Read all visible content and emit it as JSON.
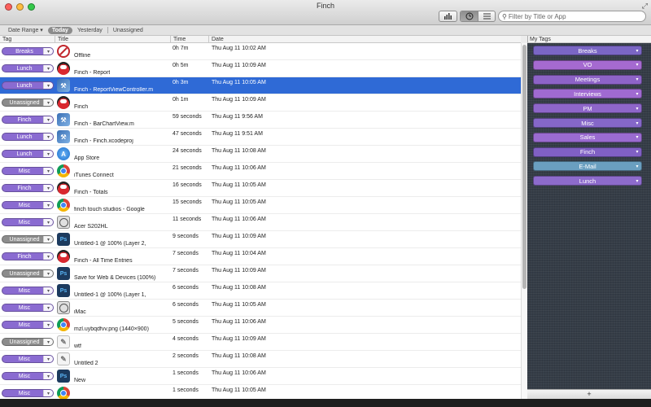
{
  "window": {
    "title": "Finch"
  },
  "toolbar": {
    "chart_icon": "bar-chart-icon",
    "clock_icon": "clock-icon",
    "list_icon": "list-icon",
    "search_placeholder": "Filter by Title or App"
  },
  "filters": {
    "date_range": "Date Range ▾",
    "today": "Today",
    "yesterday": "Yesterday",
    "unassigned": "Unassigned"
  },
  "columns": {
    "tag": "Tag",
    "title": "Title",
    "time": "Time",
    "date": "Date"
  },
  "rows": [
    {
      "tag": "Breaks",
      "tag_color": "#8a6bd1",
      "icon": "offline",
      "title": "Offline",
      "time": "0h 7m",
      "date": "Thu Aug 11 10:02 AM"
    },
    {
      "tag": "Lunch",
      "tag_color": "#8a6bd1",
      "icon": "finch",
      "title": "Finch - Report",
      "time": "0h 5m",
      "date": "Thu Aug 11 10:09 AM"
    },
    {
      "tag": "Lunch",
      "tag_color": "#8a6bd1",
      "icon": "xcode",
      "title": "Finch - ReportViewController.m",
      "time": "0h 3m",
      "date": "Thu Aug 11 10:05 AM",
      "selected": true
    },
    {
      "tag": "Unassigned",
      "tag_color": "#8c8c8c",
      "icon": "finch",
      "title": "Finch",
      "time": "0h 1m",
      "date": "Thu Aug 11 10:09 AM"
    },
    {
      "tag": "Finch",
      "tag_color": "#8a6bd1",
      "icon": "xcode",
      "title": "Finch - BarChartView.m",
      "time": "59 seconds",
      "date": "Thu Aug 11 9:56 AM"
    },
    {
      "tag": "Lunch",
      "tag_color": "#8a6bd1",
      "icon": "xcode",
      "title": "Finch - Finch.xcodeproj",
      "time": "47 seconds",
      "date": "Thu Aug 11 9:51 AM"
    },
    {
      "tag": "Lunch",
      "tag_color": "#8a6bd1",
      "icon": "appstore",
      "title": "App Store",
      "time": "24 seconds",
      "date": "Thu Aug 11 10:08 AM"
    },
    {
      "tag": "Misc",
      "tag_color": "#8a6bd1",
      "icon": "chrome",
      "title": "iTunes Connect",
      "time": "21 seconds",
      "date": "Thu Aug 11 10:06 AM"
    },
    {
      "tag": "Finch",
      "tag_color": "#8a6bd1",
      "icon": "finch",
      "title": "Finch - Totals",
      "time": "16 seconds",
      "date": "Thu Aug 11 10:05 AM"
    },
    {
      "tag": "Misc",
      "tag_color": "#8a6bd1",
      "icon": "chrome",
      "title": "finch touch studios - Google",
      "time": "15 seconds",
      "date": "Thu Aug 11 10:05 AM"
    },
    {
      "tag": "Misc",
      "tag_color": "#8a6bd1",
      "icon": "display",
      "title": "Acer S202HL",
      "time": "11 seconds",
      "date": "Thu Aug 11 10:06 AM"
    },
    {
      "tag": "Unassigned",
      "tag_color": "#8c8c8c",
      "icon": "ps",
      "title": "Untitled-1 @ 100% (Layer 2,",
      "time": "9 seconds",
      "date": "Thu Aug 11 10:09 AM"
    },
    {
      "tag": "Finch",
      "tag_color": "#8a6bd1",
      "icon": "finch",
      "title": "Finch - All Time Entries",
      "time": "7 seconds",
      "date": "Thu Aug 11 10:04 AM"
    },
    {
      "tag": "Unassigned",
      "tag_color": "#8c8c8c",
      "icon": "ps",
      "title": "Save for Web & Devices (100%)",
      "time": "7 seconds",
      "date": "Thu Aug 11 10:09 AM"
    },
    {
      "tag": "Misc",
      "tag_color": "#8a6bd1",
      "icon": "ps",
      "title": "Untitled-1 @ 100% (Layer 1,",
      "time": "6 seconds",
      "date": "Thu Aug 11 10:08 AM"
    },
    {
      "tag": "Misc",
      "tag_color": "#8a6bd1",
      "icon": "display",
      "title": "iMac",
      "time": "6 seconds",
      "date": "Thu Aug 11 10:05 AM"
    },
    {
      "tag": "Misc",
      "tag_color": "#8a6bd1",
      "icon": "chrome",
      "title": "mzl.uybqdfvv.png (1440×900)",
      "time": "5 seconds",
      "date": "Thu Aug 11 10:06 AM"
    },
    {
      "tag": "Unassigned",
      "tag_color": "#8c8c8c",
      "icon": "sketch",
      "title": "wtf",
      "time": "4 seconds",
      "date": "Thu Aug 11 10:09 AM"
    },
    {
      "tag": "Misc",
      "tag_color": "#8a6bd1",
      "icon": "sketch",
      "title": "Untitled 2",
      "time": "2 seconds",
      "date": "Thu Aug 11 10:08 AM"
    },
    {
      "tag": "Misc",
      "tag_color": "#8a6bd1",
      "icon": "ps",
      "title": "New",
      "time": "1 seconds",
      "date": "Thu Aug 11 10:06 AM"
    },
    {
      "tag": "Misc",
      "tag_color": "#8a6bd1",
      "icon": "chrome",
      "title": "",
      "time": "1 seconds",
      "date": "Thu Aug 11 10:05 AM"
    }
  ],
  "my_tags": {
    "header": "My Tags",
    "add_label": "+",
    "items": [
      {
        "label": "Breaks",
        "color": "#7a66c4"
      },
      {
        "label": "VO",
        "color": "#a56ad0"
      },
      {
        "label": "Meetings",
        "color": "#8d63c7"
      },
      {
        "label": "Interviews",
        "color": "#a06ad1"
      },
      {
        "label": "PM",
        "color": "#8e66c9"
      },
      {
        "label": "Misc",
        "color": "#8567c8"
      },
      {
        "label": "Sales",
        "color": "#9a6bd0"
      },
      {
        "label": "Finch",
        "color": "#8060c4"
      },
      {
        "label": "E-Mail",
        "color": "#6a9fc0"
      },
      {
        "label": "Lunch",
        "color": "#8d6bcc"
      }
    ]
  }
}
